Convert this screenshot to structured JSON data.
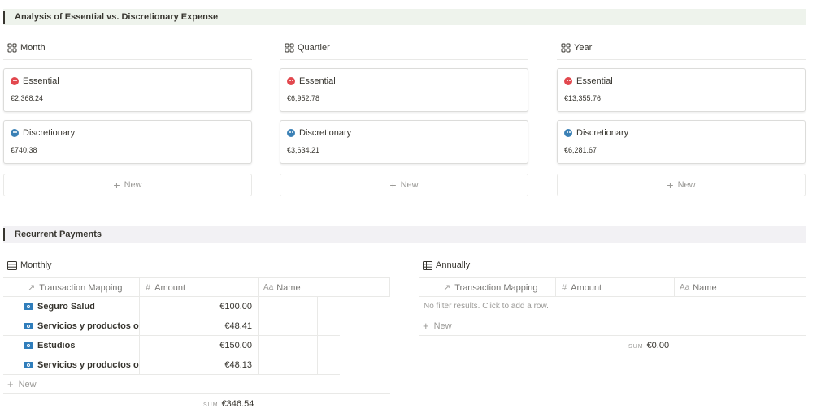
{
  "sections": {
    "analysis_title": "Analysis of Essential vs. Discretionary Expense",
    "recurrent_title": "Recurrent Payments"
  },
  "board_views": [
    {
      "label": "Month",
      "essential_label": "Essential",
      "essential_value": "€2,368.24",
      "discretionary_label": "Discretionary",
      "discretionary_value": "€740.38",
      "new_label": "New"
    },
    {
      "label": "Quartier",
      "essential_label": "Essential",
      "essential_value": "€6,952.78",
      "discretionary_label": "Discretionary",
      "discretionary_value": "€3,634.21",
      "new_label": "New"
    },
    {
      "label": "Year",
      "essential_label": "Essential",
      "essential_value": "€13,355.76",
      "discretionary_label": "Discretionary",
      "discretionary_value": "€6,281.67",
      "new_label": "New"
    }
  ],
  "monthly": {
    "label": "Monthly",
    "columns": {
      "mapping": "Transaction Mapping",
      "amount": "Amount",
      "name": "Name"
    },
    "rows": [
      {
        "title": "Seguro Salud",
        "amount": "€100.00"
      },
      {
        "title": "Servicios y productos online",
        "amount": "€48.41"
      },
      {
        "title": "Estudios",
        "amount": "€150.00"
      },
      {
        "title": "Servicios y productos online",
        "amount": "€48.13"
      }
    ],
    "new_label": "New",
    "sum_label": "SUM",
    "sum_value": "€346.54"
  },
  "annually": {
    "label": "Annually",
    "columns": {
      "mapping": "Transaction Mapping",
      "amount": "Amount",
      "name": "Name"
    },
    "empty_text": "No filter results. Click to add a row.",
    "new_label": "New",
    "sum_label": "SUM",
    "sum_value": "€0.00"
  },
  "colors": {
    "essential": "#e2484e",
    "discretionary": "#3a80b5",
    "analysis_band": "#eef3ec",
    "recurrent_band": "#f2f1f4"
  },
  "icons": {
    "board_view": "gallery-grid-icon",
    "table_view": "table-icon",
    "relation": "arrow-up-right-icon",
    "number": "hash-icon",
    "title": "text-aa-icon",
    "essential": "skull-red-icon",
    "discretionary": "skull-blue-icon",
    "row_page": "money-bill-icon"
  }
}
